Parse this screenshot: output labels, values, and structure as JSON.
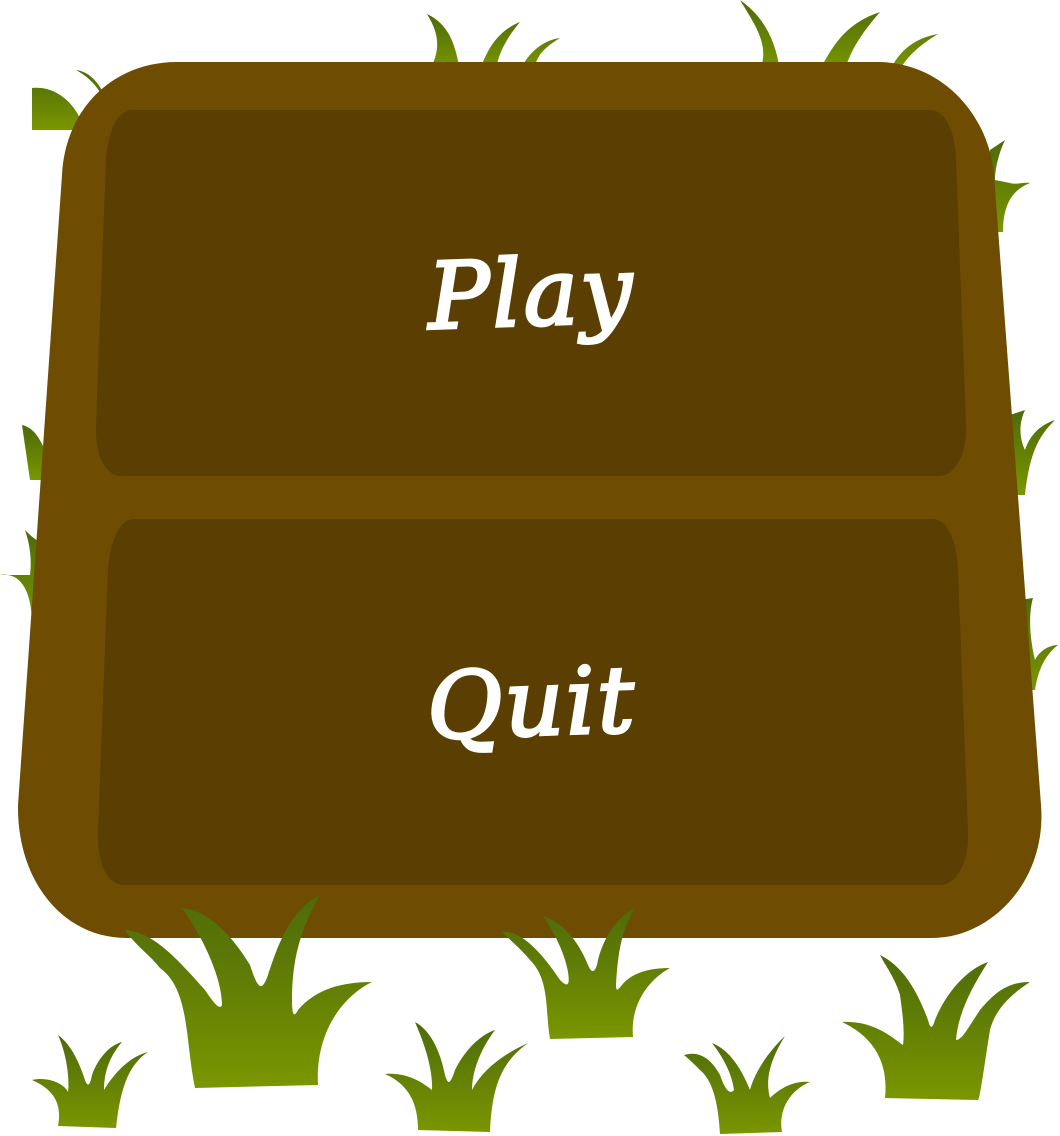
{
  "menu": {
    "play_label": "Play",
    "quit_label": "Quit"
  },
  "colors": {
    "board_frame": "#6e4c02",
    "panel": "#5a3e02",
    "grass_light": "#6f8c00",
    "grass_dark": "#4d6a0a",
    "text": "#ffffff"
  },
  "icons": {
    "decoration": "grass-tuft-icon"
  }
}
